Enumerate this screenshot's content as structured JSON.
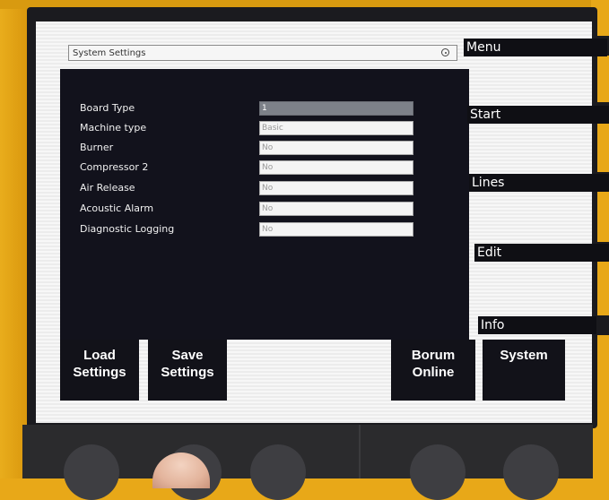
{
  "header": {
    "title": "System Settings"
  },
  "settings": [
    {
      "label": "Board Type",
      "value": "1"
    },
    {
      "label": "Machine type",
      "value": "Basic"
    },
    {
      "label": "Burner",
      "value": "No"
    },
    {
      "label": "Compressor 2",
      "value": "No"
    },
    {
      "label": "Air Release",
      "value": "No"
    },
    {
      "label": "Acoustic Alarm",
      "value": "No"
    },
    {
      "label": "Diagnostic Logging",
      "value": "No"
    }
  ],
  "side_menu": [
    "Menu",
    "Start",
    "Lines",
    "Edit",
    "Info"
  ],
  "softkeys": {
    "load": [
      "Load",
      "Settings"
    ],
    "save": [
      "Save",
      "Settings"
    ],
    "borum": [
      "Borum",
      "Online"
    ],
    "system": [
      "System"
    ]
  },
  "icons": {
    "clock": "clock-icon"
  },
  "colors": {
    "bezel": "#e8a818",
    "panel": "#12121c",
    "selected_field": "#7d8189"
  }
}
